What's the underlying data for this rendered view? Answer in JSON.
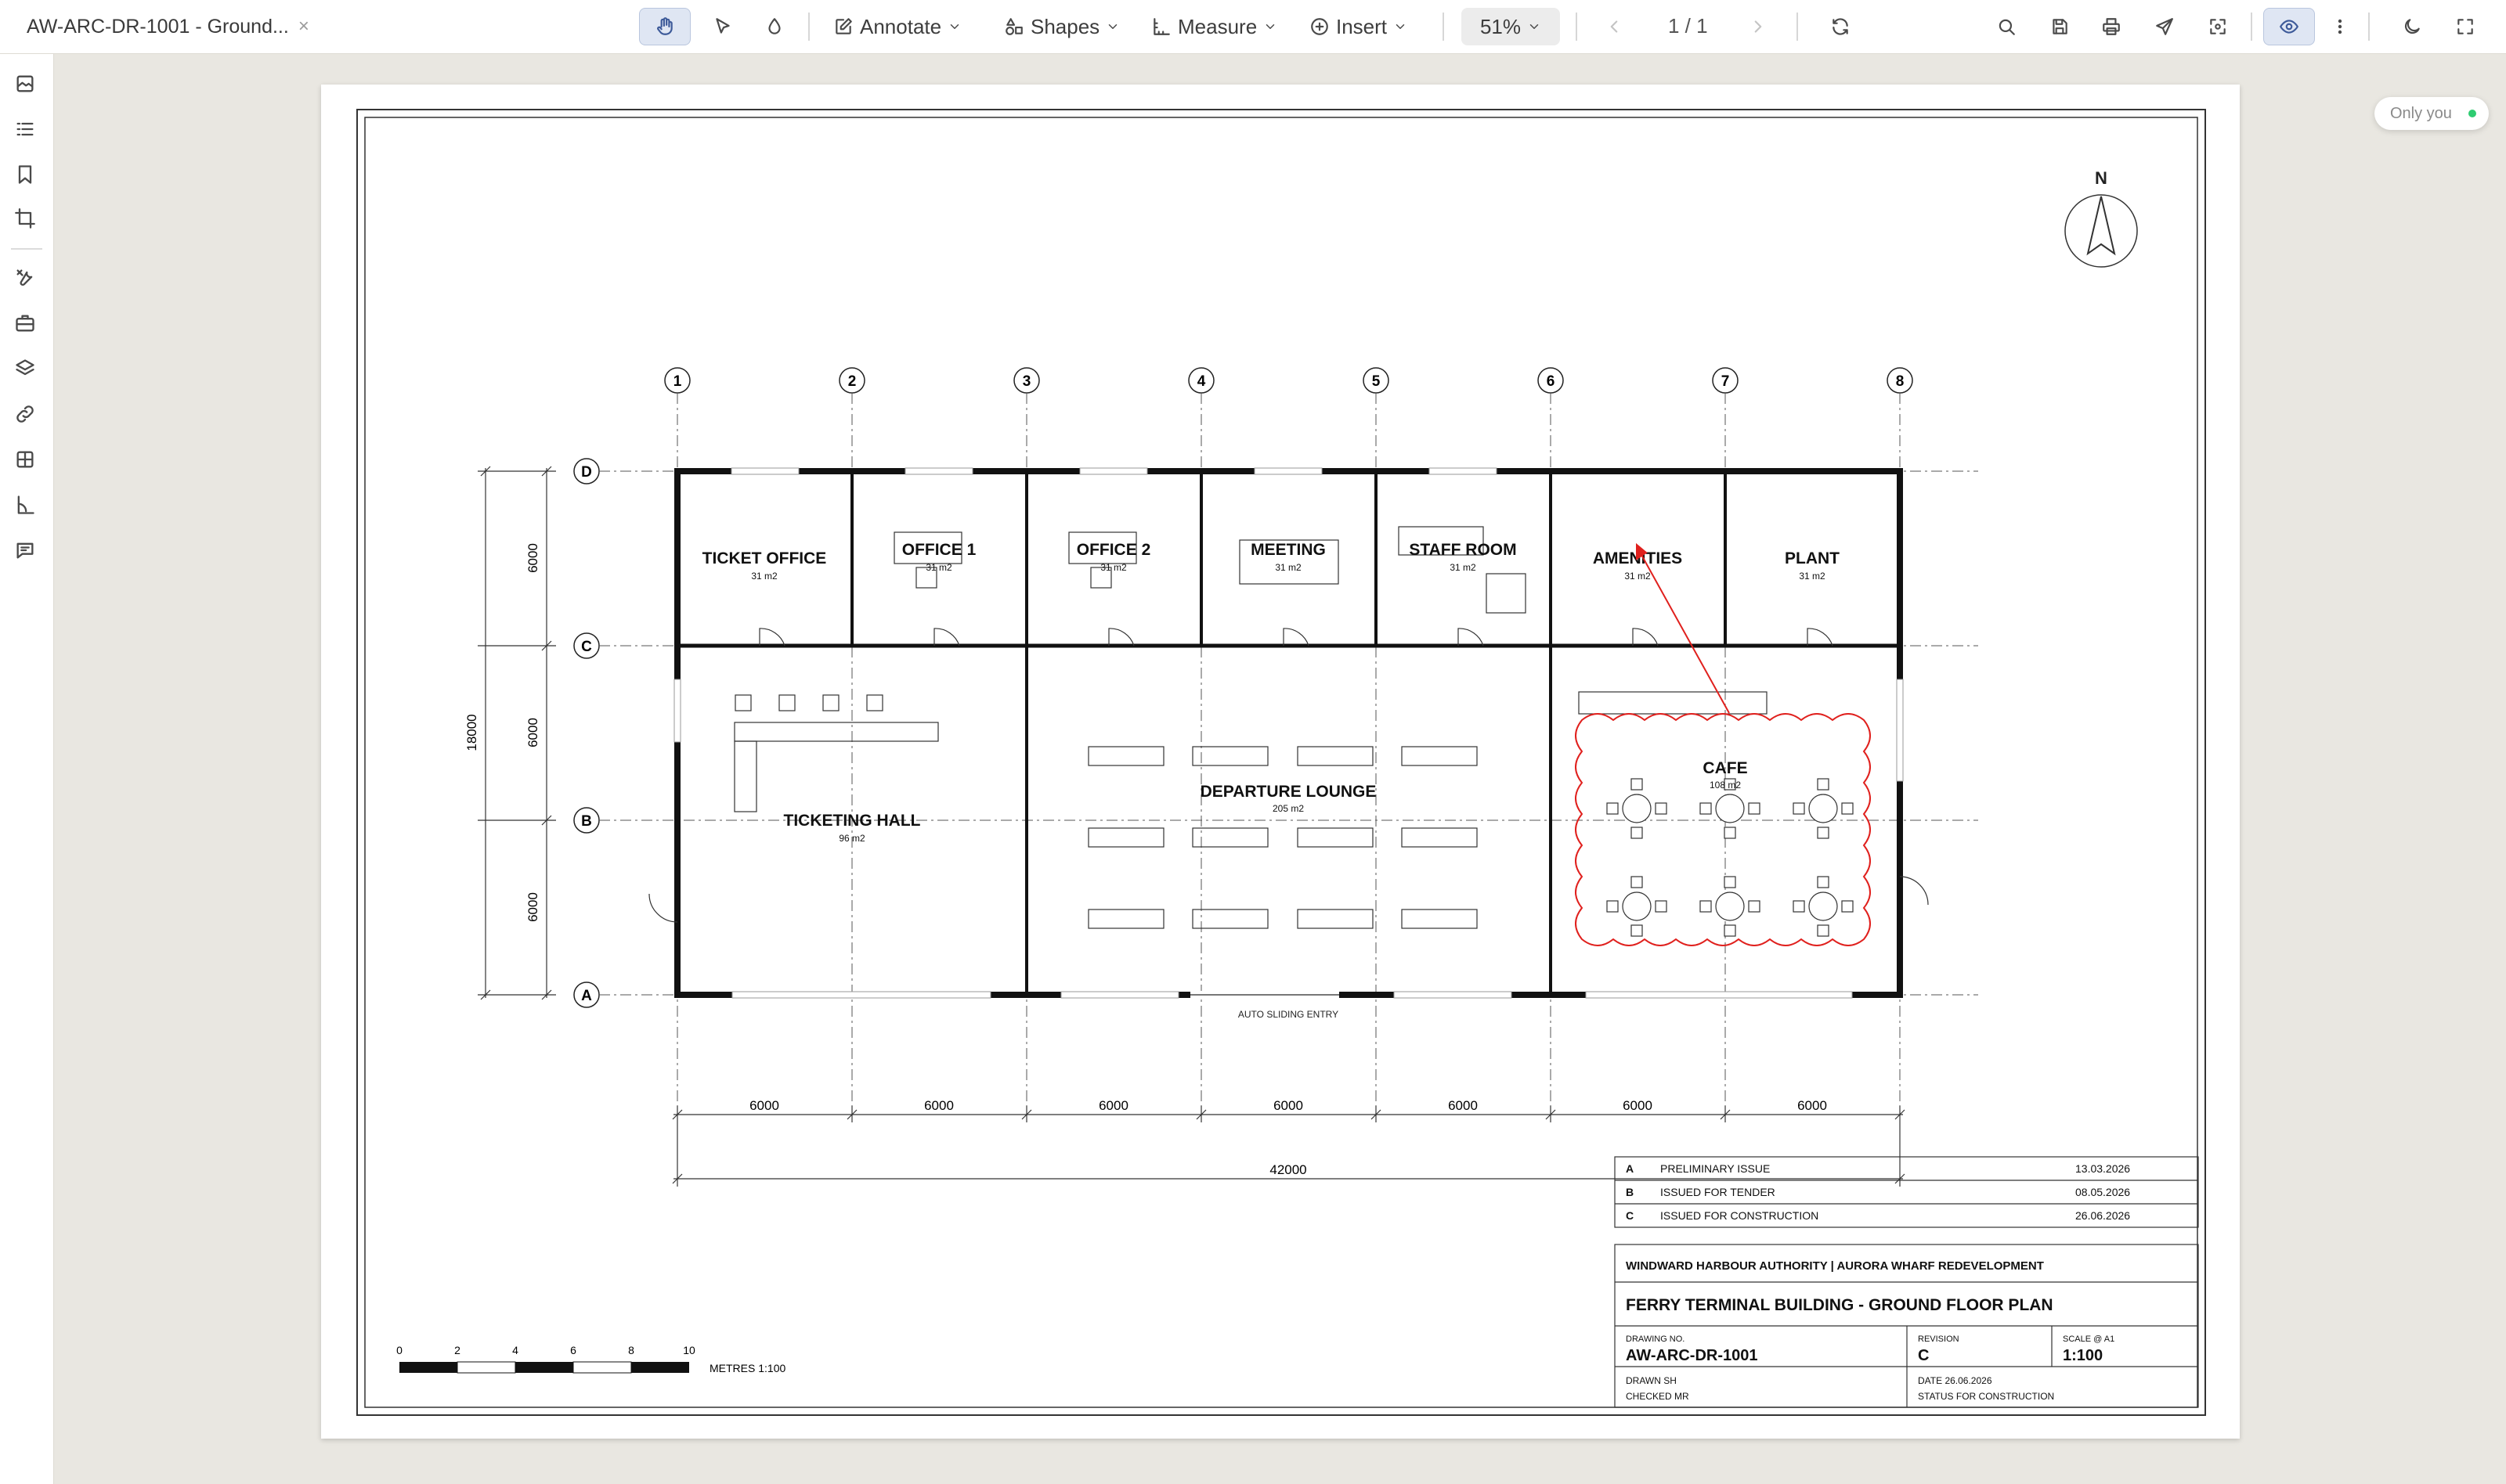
{
  "window": {
    "tab_title": "AW-ARC-DR-1001 - Ground...",
    "close_glyph": "×"
  },
  "toolbar": {
    "annotate": "Annotate",
    "shapes": "Shapes",
    "measure": "Measure",
    "insert": "Insert",
    "zoom": "51%",
    "page_indicator": "1 / 1"
  },
  "presence": {
    "label": "Only you"
  },
  "drawing": {
    "north": "N",
    "grid_columns": [
      "1",
      "2",
      "3",
      "4",
      "5",
      "6",
      "7",
      "8"
    ],
    "grid_rows": [
      "D",
      "C",
      "B",
      "A"
    ],
    "rooms": [
      {
        "name": "TICKET OFFICE",
        "area": "31 m2"
      },
      {
        "name": "OFFICE 1",
        "area": "31 m2"
      },
      {
        "name": "OFFICE 2",
        "area": "31 m2"
      },
      {
        "name": "MEETING",
        "area": "31 m2"
      },
      {
        "name": "STAFF ROOM",
        "area": "31 m2"
      },
      {
        "name": "AMENITIES",
        "area": "31 m2"
      },
      {
        "name": "PLANT",
        "area": "31 m2"
      },
      {
        "name": "TICKETING HALL",
        "area": "96 m2"
      },
      {
        "name": "DEPARTURE LOUNGE",
        "area": "205 m2"
      },
      {
        "name": "CAFE",
        "area": "108 m2"
      }
    ],
    "entry_label": "AUTO SLIDING ENTRY",
    "bay_dims": [
      "6000",
      "6000",
      "6000",
      "6000",
      "6000",
      "6000",
      "6000"
    ],
    "total_width": "42000",
    "row_dims": [
      "6000",
      "6000",
      "6000"
    ],
    "total_depth": "18000",
    "scale_bar": {
      "ticks": [
        "0",
        "2",
        "4",
        "6",
        "8",
        "10"
      ],
      "caption": "METRES  1:100"
    },
    "revisions": [
      {
        "rev": "A",
        "desc": "PRELIMINARY ISSUE",
        "date": "13.03.2026"
      },
      {
        "rev": "B",
        "desc": "ISSUED FOR TENDER",
        "date": "08.05.2026"
      },
      {
        "rev": "C",
        "desc": "ISSUED FOR CONSTRUCTION",
        "date": "26.06.2026"
      }
    ],
    "title_block": {
      "client": "WINDWARD HARBOUR AUTHORITY | AURORA WHARF REDEVELOPMENT",
      "title": "FERRY TERMINAL BUILDING - GROUND FLOOR PLAN",
      "drawing_no_label": "DRAWING NO.",
      "drawing_no": "AW-ARC-DR-1001",
      "revision_label": "REVISION",
      "revision": "C",
      "scale_label": "SCALE @ A1",
      "scale": "1:100",
      "drawn": "DRAWN  SH",
      "checked": "CHECKED  MR",
      "date": "DATE  26.06.2026",
      "status": "STATUS  FOR CONSTRUCTION"
    }
  },
  "colors": {
    "markup": "#e0201d",
    "active_tool": "#dfe6f3"
  }
}
